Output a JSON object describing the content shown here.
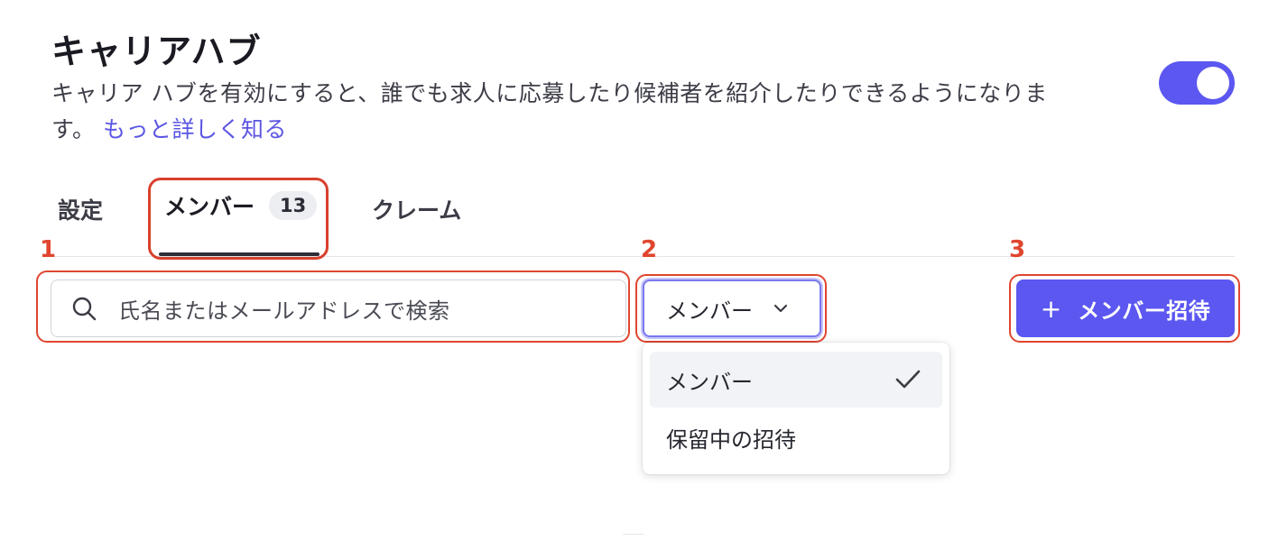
{
  "header": {
    "title": "キャリアハブ",
    "description": "キャリア ハブを有効にすると、誰でも求人に応募したり候補者を紹介したりできるようになります。",
    "learn_more": "もっと詳しく知る",
    "toggle_enabled": true
  },
  "tabs": [
    {
      "label": "設定",
      "active": false
    },
    {
      "label": "メンバー",
      "count": "13",
      "active": true
    },
    {
      "label": "クレーム",
      "active": false
    }
  ],
  "annotations": [
    "1",
    "2",
    "3"
  ],
  "search": {
    "placeholder": "氏名またはメールアドレスで検索",
    "icon": "search-icon"
  },
  "filter": {
    "selected": "メンバー",
    "options": [
      {
        "label": "メンバー",
        "selected": true
      },
      {
        "label": "保留中の招待",
        "selected": false
      }
    ]
  },
  "invite_button": {
    "icon": "+",
    "label": "メンバー招待"
  },
  "colors": {
    "accent": "#5b57f0",
    "annotation": "#e0462f",
    "link": "#5b56e3"
  }
}
